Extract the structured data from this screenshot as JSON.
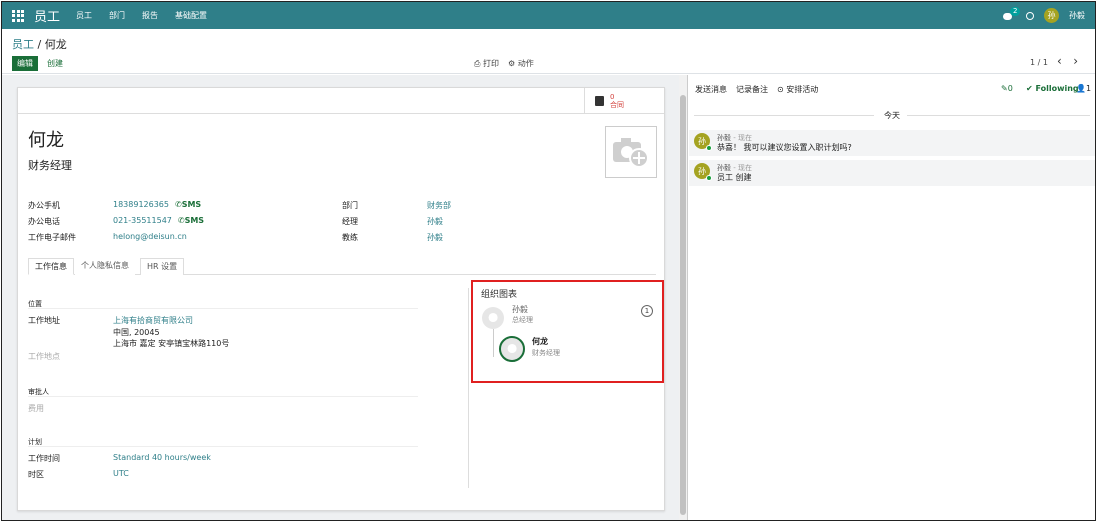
{
  "topbar": {
    "brand": "员工",
    "menu": [
      "员工",
      "部门",
      "报告",
      "基础配置"
    ],
    "chat_count": "2",
    "user_initial": "孙",
    "user_name": "孙毅"
  },
  "control": {
    "breadcrumb_root": "员工",
    "breadcrumb_sep": " / ",
    "breadcrumb_current": "何龙",
    "edit": "编辑",
    "create": "创建",
    "print": "⎙ 打印",
    "action": "⚙ 动作",
    "pager": "1 / 1",
    "prev": "‹",
    "next": "›"
  },
  "form": {
    "contract_count": "0",
    "contract_label": "合同",
    "name": "何龙",
    "job": "财务经理",
    "fields": [
      {
        "label": "办公手机",
        "value": "18389126365",
        "sms": "✆SMS"
      },
      {
        "label": "办公电话",
        "value": "021-35511547",
        "sms": "✆SMS"
      },
      {
        "label": "工作电子邮件",
        "value": "helong@deisun.cn",
        "sms": ""
      }
    ],
    "right_fields": [
      {
        "label": "部门",
        "value": "财务部"
      },
      {
        "label": "经理",
        "value": "孙毅"
      },
      {
        "label": "教练",
        "value": "孙毅"
      }
    ],
    "tabs": [
      "工作信息",
      "个人隐私信息",
      "HR 设置"
    ],
    "sect_location": "位置",
    "addr_label": "工作地址",
    "addr_company": "上海有拾商贸有限公司",
    "addr_line2": "中国, 20045",
    "addr_line3": "上海市 嘉定 安亭镇宝林路110号",
    "work_place": "工作地点",
    "sect_approver": "审批人",
    "expense": "费用",
    "sect_schedule": "计划",
    "hours_label": "工作时间",
    "hours_value": "Standard 40 hours/week",
    "tz_label": "时区",
    "tz_value": "UTC",
    "org": {
      "title": "组织图表",
      "manager_name": "孙毅",
      "manager_job": "总经理",
      "manager_count": "1",
      "self_name": "何龙",
      "self_job": "财务经理"
    }
  },
  "chatter": {
    "send": "发送消息",
    "note": "记录备注",
    "activity": "⊙ 安排活动",
    "attach": "✎0",
    "following": "✔ Following",
    "followers": "👤1",
    "today": "今天",
    "messages": [
      {
        "author": "孙毅",
        "time": " - 现在",
        "body": "恭喜！ 我可以建议您设置入职计划吗?"
      },
      {
        "author": "孙毅",
        "time": " - 现在",
        "body": "员工 创建"
      }
    ]
  },
  "colors": {
    "topbar": "#2f7f89",
    "primary": "#1a6e38",
    "highlight": "#e02020"
  }
}
